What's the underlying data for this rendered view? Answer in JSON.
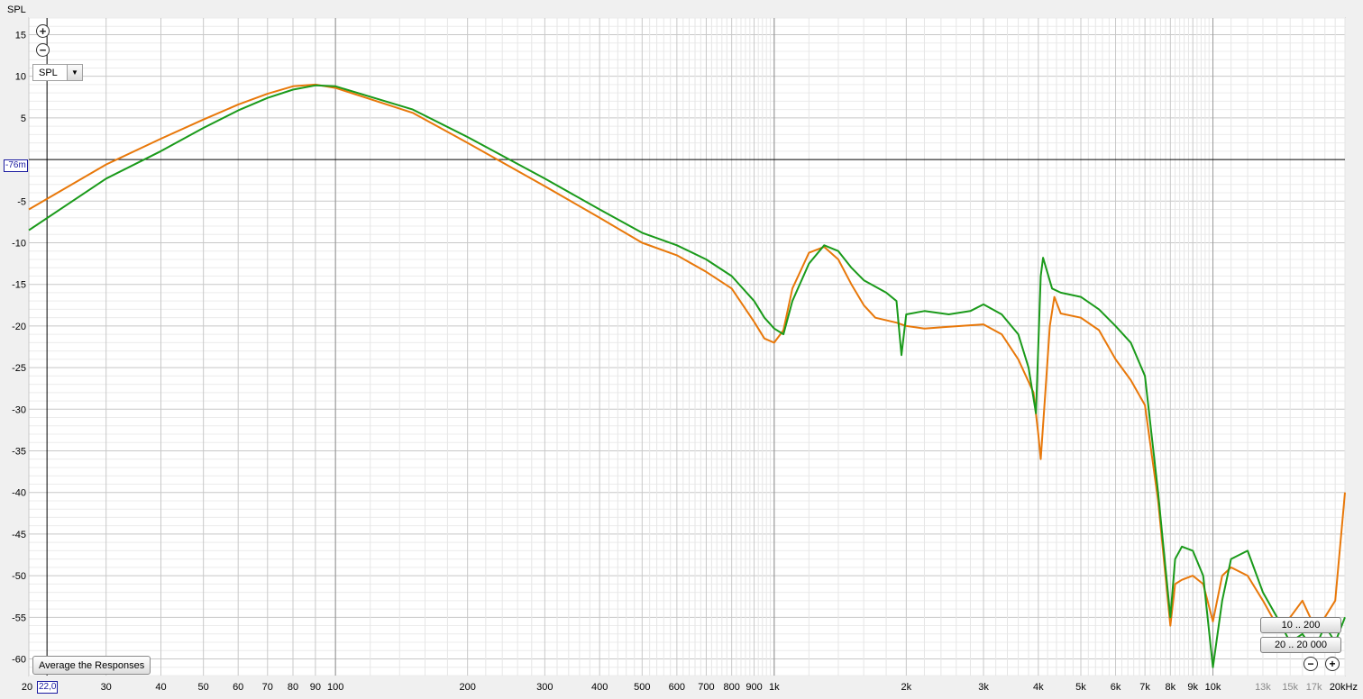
{
  "panel": {
    "ylabel": "SPL",
    "select_value": "SPL",
    "select_arrow": "▼",
    "average_button": "Average the Responses",
    "range_buttons": [
      "10 .. 200",
      "20 .. 20 000"
    ],
    "y_marker": "-76m",
    "x_marker": "22,0",
    "zoom_in": "+",
    "zoom_out": "−"
  },
  "colors": {
    "background": "#f0f0f0",
    "plot_bg": "#ffffff",
    "grid": "#d8d8d8",
    "grid_major": "#9a9a9a",
    "zero_line": "#000000",
    "series_orange": "#e8780a",
    "series_green": "#1a9a1a",
    "marker": "#1a1aa0"
  },
  "icons": {
    "zoom_in": "zoom-in-icon",
    "zoom_out": "zoom-out-icon",
    "dropdown": "chevron-down-icon"
  },
  "chart_data": {
    "type": "line",
    "title": "",
    "xlabel": "",
    "ylabel": "SPL",
    "x_scale": "log",
    "xlim": [
      20,
      20000
    ],
    "ylim": [
      -62,
      17
    ],
    "grid": true,
    "y_ticks": [
      15,
      10,
      5,
      0,
      -5,
      -10,
      -15,
      -20,
      -25,
      -30,
      -35,
      -40,
      -45,
      -50,
      -55,
      -60
    ],
    "y_tick_labels": [
      "15",
      "10",
      "5",
      "",
      "-5",
      "-10",
      "-15",
      "-20",
      "-25",
      "-30",
      "-35",
      "-40",
      "-45",
      "-50",
      "-55",
      "-60"
    ],
    "x_ticks": [
      20,
      30,
      40,
      50,
      60,
      70,
      80,
      90,
      100,
      200,
      300,
      400,
      500,
      600,
      700,
      800,
      900,
      1000,
      2000,
      3000,
      4000,
      5000,
      6000,
      7000,
      8000,
      9000,
      10000,
      13000,
      15000,
      17000,
      20000
    ],
    "x_tick_labels": [
      "20",
      "30",
      "40",
      "50",
      "60",
      "70",
      "80",
      "90",
      "100",
      "200",
      "300",
      "400",
      "500",
      "600",
      "700",
      "800",
      "900",
      "1k",
      "2k",
      "3k",
      "4k",
      "5k",
      "6k",
      "7k",
      "8k",
      "9k",
      "10k",
      "13k",
      "15k",
      "17k",
      "20kHz"
    ],
    "series": [
      {
        "color": "#e8780a",
        "points": [
          [
            20,
            -6
          ],
          [
            30,
            -0.6
          ],
          [
            40,
            2.5
          ],
          [
            50,
            4.8
          ],
          [
            60,
            6.6
          ],
          [
            70,
            7.9
          ],
          [
            80,
            8.8
          ],
          [
            90,
            9
          ],
          [
            100,
            8.6
          ],
          [
            150,
            5.6
          ],
          [
            200,
            2
          ],
          [
            300,
            -3.2
          ],
          [
            400,
            -7
          ],
          [
            500,
            -10
          ],
          [
            600,
            -11.5
          ],
          [
            700,
            -13.5
          ],
          [
            800,
            -15.5
          ],
          [
            900,
            -19.5
          ],
          [
            950,
            -21.5
          ],
          [
            1000,
            -22
          ],
          [
            1050,
            -20.5
          ],
          [
            1100,
            -15.5
          ],
          [
            1200,
            -11.2
          ],
          [
            1300,
            -10.5
          ],
          [
            1400,
            -12
          ],
          [
            1500,
            -15
          ],
          [
            1600,
            -17.5
          ],
          [
            1700,
            -19
          ],
          [
            1900,
            -19.6
          ],
          [
            2000,
            -20
          ],
          [
            2200,
            -20.3
          ],
          [
            2500,
            -20.1
          ],
          [
            3000,
            -19.8
          ],
          [
            3300,
            -21
          ],
          [
            3600,
            -24
          ],
          [
            3900,
            -28
          ],
          [
            4000,
            -33
          ],
          [
            4050,
            -36
          ],
          [
            4150,
            -28
          ],
          [
            4250,
            -20
          ],
          [
            4350,
            -16.5
          ],
          [
            4500,
            -18.5
          ],
          [
            5000,
            -19
          ],
          [
            5500,
            -20.5
          ],
          [
            6000,
            -24
          ],
          [
            6500,
            -26.5
          ],
          [
            7000,
            -29.5
          ],
          [
            7500,
            -41
          ],
          [
            8000,
            -56
          ],
          [
            8200,
            -51
          ],
          [
            8500,
            -50.5
          ],
          [
            9000,
            -50
          ],
          [
            9500,
            -51
          ],
          [
            10000,
            -55.5
          ],
          [
            10500,
            -50
          ],
          [
            11000,
            -49
          ],
          [
            12000,
            -50
          ],
          [
            13000,
            -53
          ],
          [
            14000,
            -56
          ],
          [
            15000,
            -55
          ],
          [
            16000,
            -53
          ],
          [
            17000,
            -56
          ],
          [
            18000,
            -55
          ],
          [
            19000,
            -53
          ],
          [
            20000,
            -40
          ]
        ]
      },
      {
        "color": "#1a9a1a",
        "points": [
          [
            20,
            -8.5
          ],
          [
            30,
            -2.3
          ],
          [
            40,
            1
          ],
          [
            50,
            3.8
          ],
          [
            60,
            5.9
          ],
          [
            70,
            7.4
          ],
          [
            80,
            8.4
          ],
          [
            90,
            8.9
          ],
          [
            100,
            8.8
          ],
          [
            150,
            6
          ],
          [
            200,
            2.7
          ],
          [
            300,
            -2.3
          ],
          [
            400,
            -6
          ],
          [
            500,
            -8.8
          ],
          [
            600,
            -10.3
          ],
          [
            700,
            -12
          ],
          [
            800,
            -14
          ],
          [
            900,
            -17
          ],
          [
            950,
            -19
          ],
          [
            1000,
            -20.3
          ],
          [
            1050,
            -21
          ],
          [
            1100,
            -17
          ],
          [
            1200,
            -12.5
          ],
          [
            1300,
            -10.3
          ],
          [
            1400,
            -11
          ],
          [
            1500,
            -13
          ],
          [
            1600,
            -14.5
          ],
          [
            1800,
            -16
          ],
          [
            1900,
            -17
          ],
          [
            1950,
            -23.5
          ],
          [
            2000,
            -18.6
          ],
          [
            2200,
            -18.2
          ],
          [
            2500,
            -18.6
          ],
          [
            2800,
            -18.2
          ],
          [
            3000,
            -17.4
          ],
          [
            3300,
            -18.6
          ],
          [
            3600,
            -21
          ],
          [
            3800,
            -25
          ],
          [
            3950,
            -30.5
          ],
          [
            4050,
            -14
          ],
          [
            4100,
            -11.8
          ],
          [
            4300,
            -15.5
          ],
          [
            4500,
            -16
          ],
          [
            5000,
            -16.5
          ],
          [
            5500,
            -18
          ],
          [
            6000,
            -20
          ],
          [
            6500,
            -22
          ],
          [
            7000,
            -26
          ],
          [
            7500,
            -40
          ],
          [
            8000,
            -55
          ],
          [
            8200,
            -48
          ],
          [
            8500,
            -46.5
          ],
          [
            9000,
            -47
          ],
          [
            9500,
            -50
          ],
          [
            10000,
            -61
          ],
          [
            10500,
            -53
          ],
          [
            11000,
            -48
          ],
          [
            12000,
            -47
          ],
          [
            13000,
            -52
          ],
          [
            14000,
            -55
          ],
          [
            15000,
            -58
          ],
          [
            16000,
            -57
          ],
          [
            17000,
            -59
          ],
          [
            18000,
            -56
          ],
          [
            19000,
            -58
          ],
          [
            20000,
            -55
          ]
        ]
      }
    ]
  }
}
